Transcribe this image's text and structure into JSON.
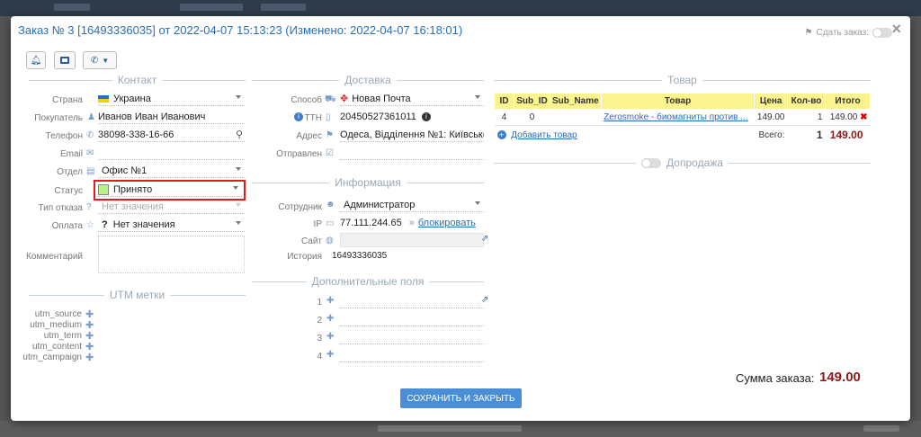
{
  "title": "Заказ № 3 [16493336035] от 2022-04-07 15:13:23 (Изменено: 2022-04-07 16:18:01)",
  "handover_label": "Сдать заказ:",
  "close_glyph": "×",
  "sections": {
    "contact": "Контакт",
    "delivery": "Доставка",
    "goods": "Товар",
    "info": "Информация",
    "extra": "Дополнительные поля",
    "utm": "UTM метки",
    "upsell": "Допродажа"
  },
  "contact": {
    "country_label": "Страна",
    "country": "Украина",
    "buyer_label": "Покупатель",
    "buyer": "Иванов Иван Иванович",
    "phone_label": "Телефон",
    "phone": "38098-338-16-66",
    "email_label": "Email",
    "email": "",
    "office_label": "Отдел",
    "office": "Офис №1",
    "status_label": "Статус",
    "status": "Принято",
    "refusal_label": "Тип отказа",
    "refusal": "Нет значения",
    "payment_label": "Оплата",
    "payment": "Нет значения",
    "comment_label": "Комментарий"
  },
  "delivery": {
    "method_label": "Способ",
    "method": "Новая Почта",
    "ttn_label": "ТТН",
    "ttn": "20450527361011",
    "address_label": "Адрес",
    "address": "Одеса, Відділення №1: Київське",
    "sent_label": "Отправлен"
  },
  "info": {
    "employee_label": "Сотрудник",
    "employee": "Администратор",
    "ip_label": "IP",
    "ip": "77.111.244.65",
    "block_link": "блокировать",
    "site_label": "Сайт",
    "history_label": "История",
    "history": "16493336035"
  },
  "extra_fields": [
    "1",
    "2",
    "3",
    "4"
  ],
  "utm": [
    "utm_source",
    "utm_medium",
    "utm_term",
    "utm_content",
    "utm_campaign"
  ],
  "goods": {
    "headers": [
      "ID",
      "Sub_ID",
      "Sub_Name",
      "Товар",
      "Цена",
      "Кол-во",
      "Итого"
    ],
    "row": {
      "id": "4",
      "sub_id": "0",
      "sub_name": "",
      "product": "Zerosmoke - биомагниты против ...",
      "price": "149.00",
      "qty": "1",
      "total": "149.00"
    },
    "add_label": "Добавить товар",
    "total_label": "Всего:",
    "total_qty": "1",
    "total_sum": "149.00"
  },
  "sum_label": "Сумма заказа:",
  "sum_value": "149.00",
  "save_button": "СОХРАНИТЬ И ЗАКРЫТЬ",
  "colors": {
    "accent": "#2a6ebb",
    "header_yellow": "#fbf48e",
    "highlight": "#e01b1b",
    "total_red": "#8b1a1a"
  }
}
